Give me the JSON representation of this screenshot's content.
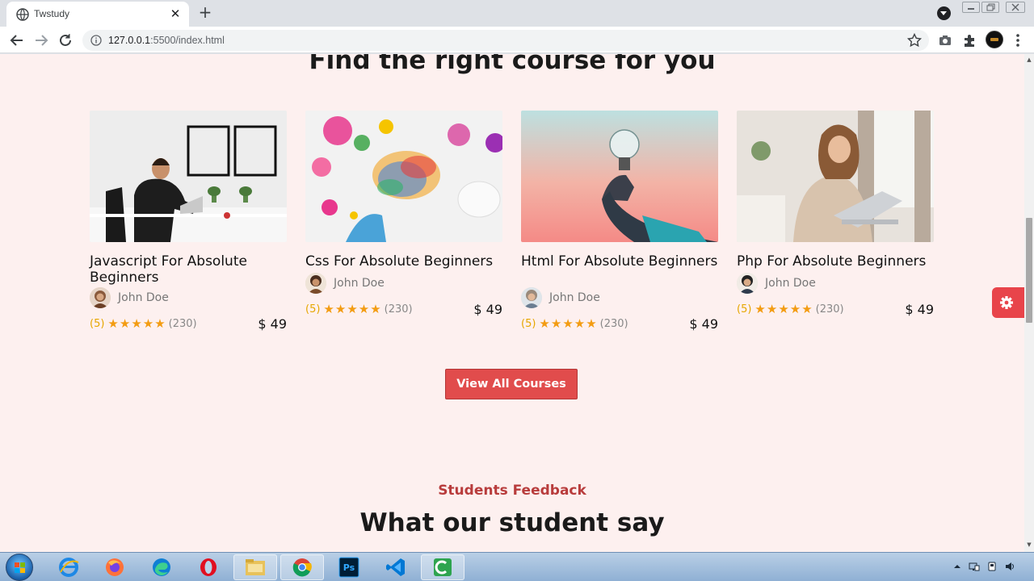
{
  "browser": {
    "tab_title": "Twstudy",
    "tab_close": "✕",
    "new_tab": "+",
    "url_host": "127.0.0.1",
    "url_path": ":5500/index.html"
  },
  "page": {
    "courses_heading": "Find the right course for you",
    "view_all_label": "View All Courses",
    "feedback_subtitle": "Students Feedback",
    "feedback_heading": "What our student say"
  },
  "courses": [
    {
      "title": "Javascript For Absolute Beginners",
      "teacher": "John Doe",
      "rating": "(5)",
      "stars": "★★★★★",
      "reviews": "(230)",
      "price": "$ 49"
    },
    {
      "title": "Css For Absolute Beginners",
      "teacher": "John Doe",
      "rating": "(5)",
      "stars": "★★★★★",
      "reviews": "(230)",
      "price": "$ 49"
    },
    {
      "title": "Html For Absolute Beginners",
      "teacher": "John Doe",
      "rating": "(5)",
      "stars": "★★★★★",
      "reviews": "(230)",
      "price": "$ 49"
    },
    {
      "title": "Php For Absolute Beginners",
      "teacher": "John Doe",
      "rating": "(5)",
      "stars": "★★★★★",
      "reviews": "(230)",
      "price": "$ 49"
    }
  ],
  "colors": {
    "accent": "#e14c4c",
    "page_bg": "#fdf0ef",
    "star": "#f39c12"
  },
  "taskbar": {
    "apps": [
      "internet-explorer-icon",
      "firefox-icon",
      "edge-icon",
      "opera-icon",
      "file-explorer-icon",
      "chrome-icon",
      "photoshop-icon",
      "vscode-icon",
      "camtasia-icon"
    ],
    "photoshop_label": "Ps"
  }
}
